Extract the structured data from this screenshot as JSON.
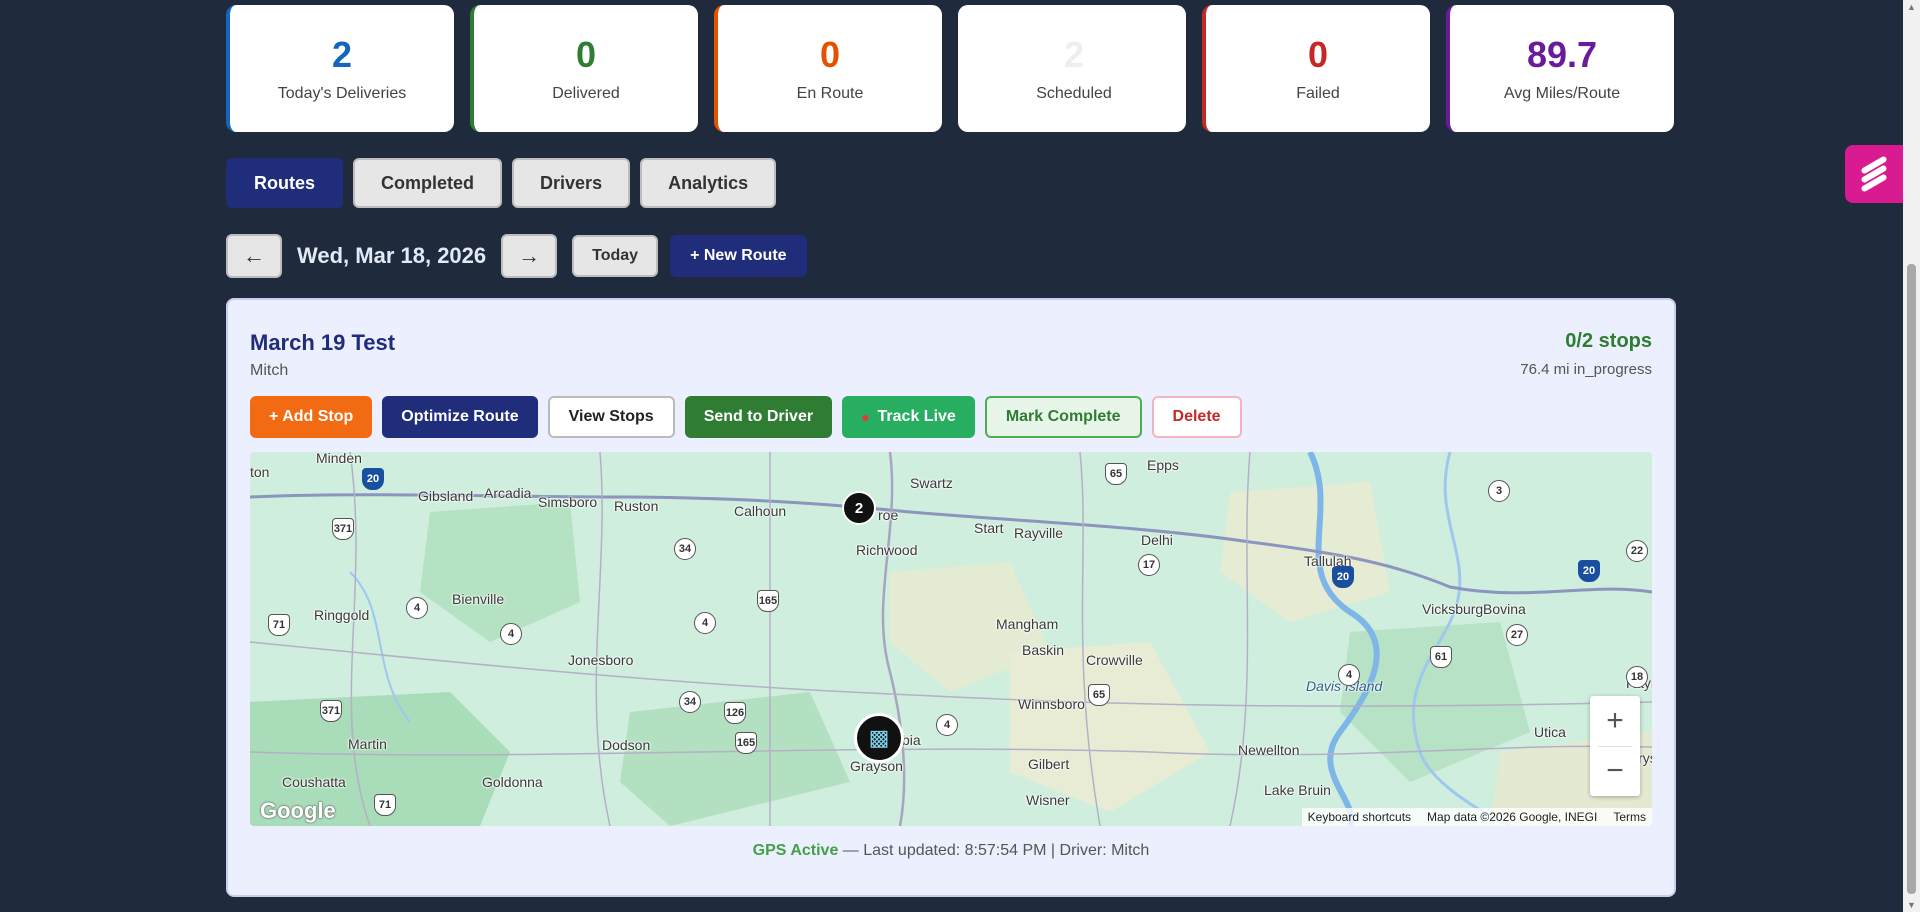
{
  "stats": [
    {
      "value": "2",
      "label": "Today's Deliveries",
      "color": "#1565c0"
    },
    {
      "value": "0",
      "label": "Delivered",
      "color": "#2e7d32"
    },
    {
      "value": "0",
      "label": "En Route",
      "color": "#e65100"
    },
    {
      "value": "2",
      "label": "Scheduled",
      "color": "#eceff1"
    },
    {
      "value": "0",
      "label": "Failed",
      "color": "#c62828"
    },
    {
      "value": "89.7",
      "label": "Avg Miles/Route",
      "color": "#6a1b9a"
    }
  ],
  "tabs": [
    {
      "label": "Routes",
      "active": true
    },
    {
      "label": "Completed",
      "active": false
    },
    {
      "label": "Drivers",
      "active": false
    },
    {
      "label": "Analytics",
      "active": false
    }
  ],
  "datenav": {
    "prev": "←",
    "date": "Wed, Mar 18, 2026",
    "next": "→",
    "today": "Today",
    "new_route": "+ New Route"
  },
  "route": {
    "name": "March 19 Test",
    "driver": "Mitch",
    "stops": "0/2 stops",
    "meta": "76.4 mi in_progress",
    "actions": {
      "add_stop": "+ Add Stop",
      "optimize": "Optimize Route",
      "view_stops": "View Stops",
      "send": "Send to Driver",
      "track": "Track Live",
      "mark_complete": "Mark Complete",
      "delete": "Delete"
    }
  },
  "map": {
    "places": [
      "Minden",
      "Gibsland",
      "Arcadia",
      "Simsboro",
      "Ruston",
      "Calhoun",
      "Swartz",
      "roe",
      "Start",
      "Rayville",
      "Epps",
      "Delhi",
      "Tallulah",
      "Vicksburg",
      "Bovina",
      "Richwood",
      "Ringgold",
      "Bienville",
      "Jonesboro",
      "Mangham",
      "Baskin",
      "Crowville",
      "Winnsboro",
      "Davis Island",
      "Martin",
      "Dodson",
      "Coushatta",
      "Goldonna",
      "Grayson",
      "bia",
      "Gilbert",
      "Newellton",
      "Wisner",
      "Lake Bruin",
      "Utica",
      "Raym",
      "Crys",
      "ton"
    ],
    "marker_stop": "2",
    "zoom_in": "+",
    "zoom_out": "−",
    "logo": "Google",
    "attribution": {
      "shortcuts": "Keyboard shortcuts",
      "data": "Map data ©2026 Google, INEGI",
      "terms": "Terms"
    }
  },
  "gps": {
    "status": "GPS Active",
    "rest": " — Last updated: 8:57:54 PM | Driver: Mitch"
  },
  "icons": {
    "marker_icon": "delivery-truck-icon",
    "pin_icon": "map-pin-icon",
    "widget_icon": "chat-widget-icon"
  }
}
